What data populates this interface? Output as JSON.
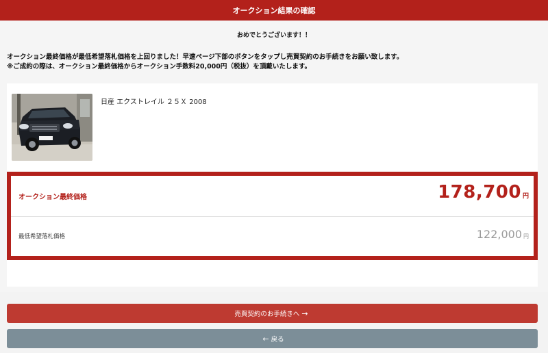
{
  "header": {
    "title": "オークション結果の確認"
  },
  "message": {
    "congrats": "おめでとうございます！！",
    "line1": "オークション最終価格が最低希望落札価格を上回りました！早速ページ下部のボタンをタップし売買契約のお手続きをお願い致します。",
    "line2": "※ご成約の際は、オークション最終価格からオークション手数料20,000円（税抜）を頂戴いたします。"
  },
  "vehicle": {
    "name": "日産 エクストレイル ２５Ｘ 2008"
  },
  "prices": {
    "final_label": "オークション最終価格",
    "final_value": "178,700",
    "final_unit": "円",
    "min_label": "最低希望落札価格",
    "min_value": "122,000",
    "min_unit": "円"
  },
  "buttons": {
    "contract_label": "売買契約のお手続きへ",
    "contract_icon": "arrow-right-icon",
    "back_label": "戻る",
    "back_icon": "arrow-left-icon"
  },
  "colors": {
    "brand_red": "#b3211b",
    "button_red": "#be3a31",
    "button_gray": "#7c8e98"
  }
}
